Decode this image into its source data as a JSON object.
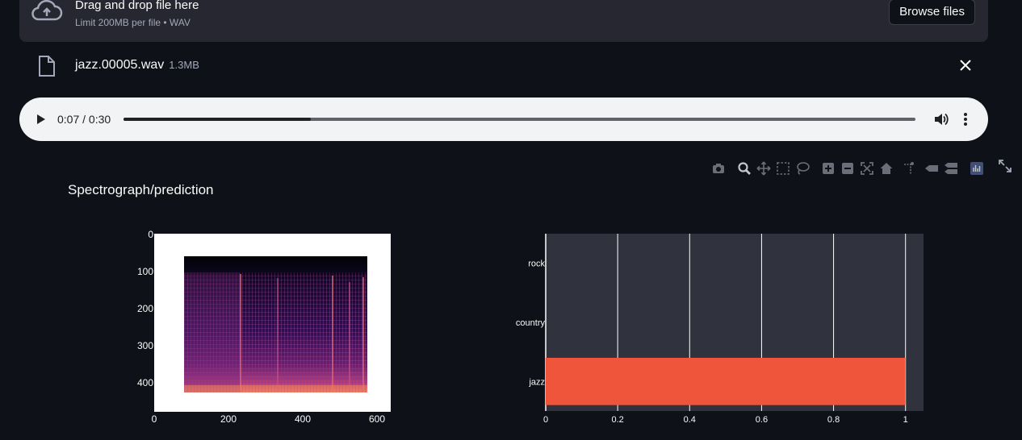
{
  "uploader": {
    "title": "Drag and drop file here",
    "limit": "Limit 200MB per file • WAV",
    "browse_label": "Browse files"
  },
  "file": {
    "name": "jazz.00005.wav",
    "size": "1.3MB"
  },
  "audio": {
    "time": "0:07 / 0:30",
    "progress": 0.236
  },
  "figure": {
    "title": "Spectrograph/prediction",
    "image_panel": {
      "x_ticks": [
        "0",
        "200",
        "400",
        "600"
      ],
      "y_ticks": [
        "0",
        "100",
        "200",
        "300",
        "400"
      ]
    }
  },
  "modebar": [
    "camera-icon",
    "zoom-icon",
    "pan-icon",
    "box-select-icon",
    "lasso-icon",
    "zoom-in-icon",
    "zoom-out-icon",
    "autoscale-icon",
    "reset-axes-icon",
    "spike-lines-icon",
    "hover-closest-icon",
    "hover-compare-icon",
    "plotly-logo-icon",
    "fullscreen-icon"
  ],
  "chart_data": {
    "type": "bar",
    "orientation": "horizontal",
    "categories": [
      "jazz",
      "country",
      "rock"
    ],
    "values": [
      1,
      0,
      0
    ],
    "xlim": [
      0,
      1.05
    ],
    "x_ticks": [
      0,
      0.2,
      0.4,
      0.6,
      0.8,
      1
    ],
    "x_tick_labels": [
      "0",
      "0.2",
      "0.4",
      "0.6",
      "0.8",
      "1"
    ],
    "bar_color": "#ef553b",
    "plot_bg": "#30323d",
    "grid": true
  },
  "colors": {
    "background": "#0e1117",
    "panel": "#262730",
    "player": "#f1f3f4"
  }
}
